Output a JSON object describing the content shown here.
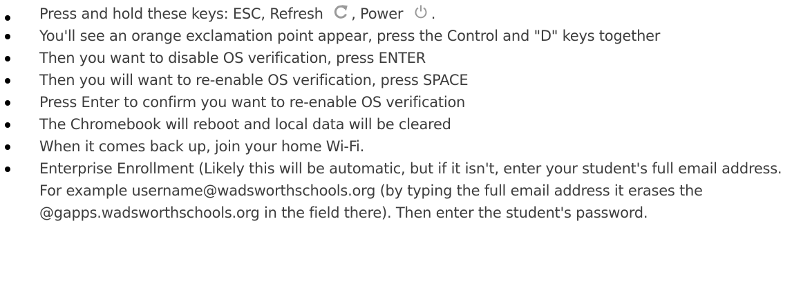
{
  "steps": [
    {
      "parts": {
        "before": "Press and hold these keys: ESC, Refresh",
        "middle": ", Power",
        "after": "."
      },
      "icons": [
        "refresh-icon",
        "power-icon"
      ]
    },
    {
      "text": "You'll see an orange exclamation point appear, press the Control and \"D\" keys together"
    },
    {
      "text": "Then you want to disable OS verification, press ENTER"
    },
    {
      "text": "Then you will want to re-enable OS verification, press SPACE"
    },
    {
      "text": "Press Enter to confirm you want to re-enable OS verification"
    },
    {
      "text": "The Chromebook will reboot and local data will be cleared"
    },
    {
      "text": "When it comes back up, join your home Wi-Fi."
    },
    {
      "text": "Enterprise Enrollment (Likely this will be automatic, but if it isn't, enter your student's full email address.  For example username@wadsworthschools.org (by typing the full email address it erases the @gapps.wadsworthschools.org in the field there).  Then enter the student's password."
    }
  ],
  "colors": {
    "text": "#3d3d3d",
    "bullet": "#000000",
    "icon": "#9a9a9a"
  }
}
